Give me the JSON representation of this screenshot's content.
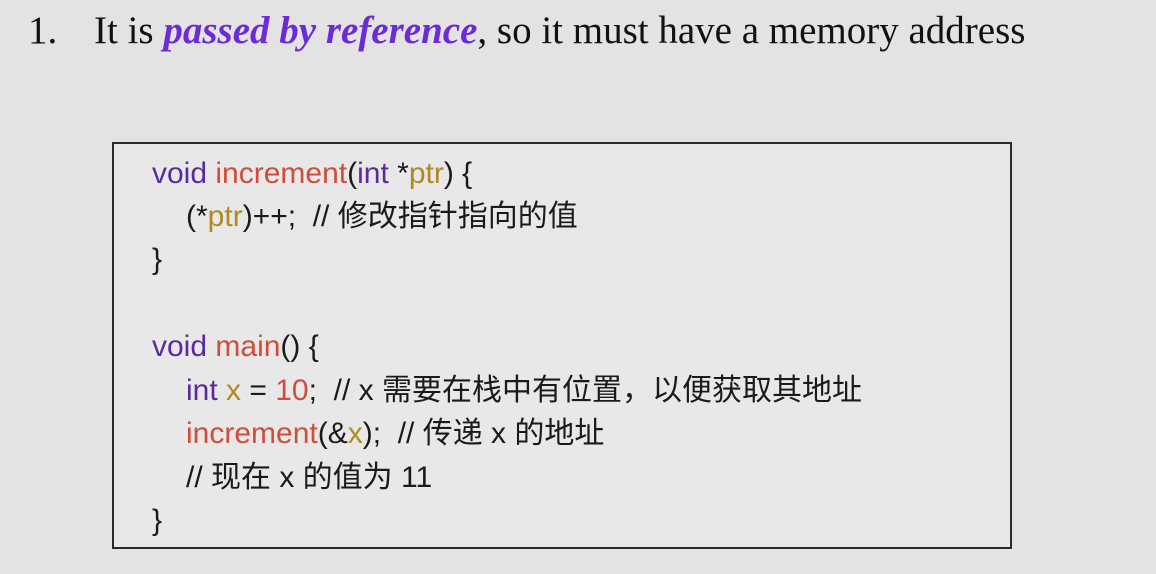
{
  "heading": {
    "number": "1.",
    "before": "It is ",
    "emphasis": "passed by reference",
    "after": ", so it must have a memory address"
  },
  "code": {
    "l1": {
      "kw": "void",
      "sp": " ",
      "fn": "increment",
      "p1": "(",
      "kw2": "int",
      "p2": " *",
      "var": "ptr",
      "p3": ") {"
    },
    "l2": {
      "p1": "(*",
      "var": "ptr",
      "p2": ")++;  // 修改指针指向的值"
    },
    "l3": {
      "p1": "}"
    },
    "l5": {
      "kw": "void",
      "sp": " ",
      "fn": "main",
      "p1": "() {"
    },
    "l6": {
      "kw": "int",
      "sp": " ",
      "var": "x",
      "p1": " = ",
      "num": "10",
      "p2": ";  // x 需要在栈中有位置，以便获取其地址"
    },
    "l7": {
      "fn": "increment",
      "p1": "(&",
      "var": "x",
      "p2": ");  // 传递 x 的地址"
    },
    "l8": {
      "p1": "// 现在 x 的值为 11"
    },
    "l9": {
      "p1": "}"
    }
  },
  "colors": {
    "keyword": "#5b2a9e",
    "function": "#cf4d3a",
    "variable": "#b08a1e",
    "number": "#cf4d3a",
    "emphasis": "#6c2bd9"
  }
}
